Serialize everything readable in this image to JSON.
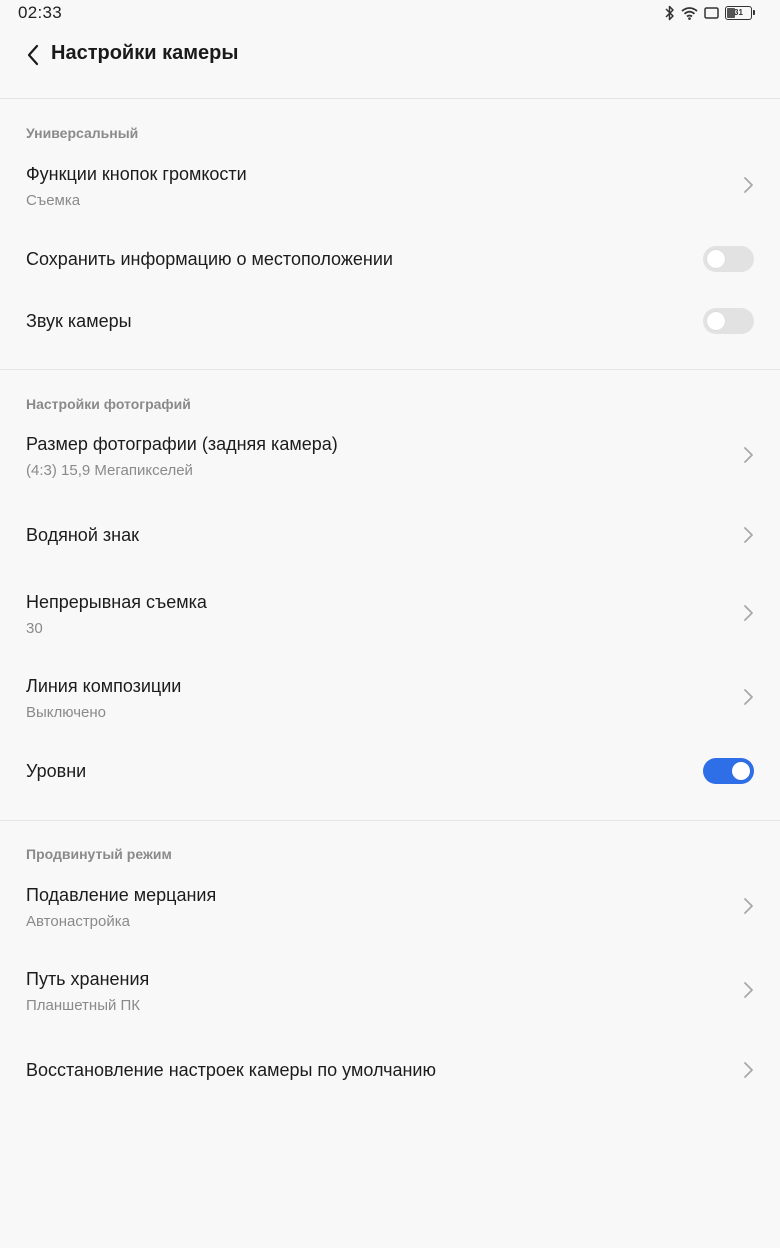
{
  "status_bar": {
    "time": "02:33",
    "icons": [
      "bluetooth-icon",
      "wifi-icon",
      "screen-rotation-icon",
      "battery-icon"
    ],
    "battery_level": "31"
  },
  "header": {
    "title": "Настройки камеры",
    "back_icon": "chevron-left-icon"
  },
  "sections": {
    "universal": {
      "title": "Универсальный",
      "volume_keys": {
        "title": "Функции кнопок громкости",
        "value": "Съемка"
      },
      "save_location": {
        "title": "Сохранить информацию о местоположении",
        "enabled": false
      },
      "camera_sound": {
        "title": "Звук камеры",
        "enabled": false
      }
    },
    "photo": {
      "title": "Настройки фотографий",
      "photo_size": {
        "title": "Размер фотографии (задняя камера)",
        "value": "(4:3) 15,9 Мегапикселей"
      },
      "watermark": {
        "title": "Водяной знак"
      },
      "burst": {
        "title": "Непрерывная съемка",
        "value": "30"
      },
      "grid_lines": {
        "title": "Линия композиции",
        "value": "Выключено"
      },
      "level": {
        "title": "Уровни",
        "enabled": true
      }
    },
    "advanced": {
      "title": "Продвинутый режим",
      "anti_flicker": {
        "title": "Подавление мерцания",
        "value": "Автонастройка"
      },
      "storage_path": {
        "title": "Путь хранения",
        "value": "Планшетный ПК"
      },
      "reset": {
        "title": "Восстановление настроек камеры по умолчанию"
      }
    }
  },
  "colors": {
    "background": "#f8f8f8",
    "toggle_on": "#2e6ee6",
    "toggle_off": "#e2e2e2",
    "secondary_text": "#8a8a8a"
  }
}
